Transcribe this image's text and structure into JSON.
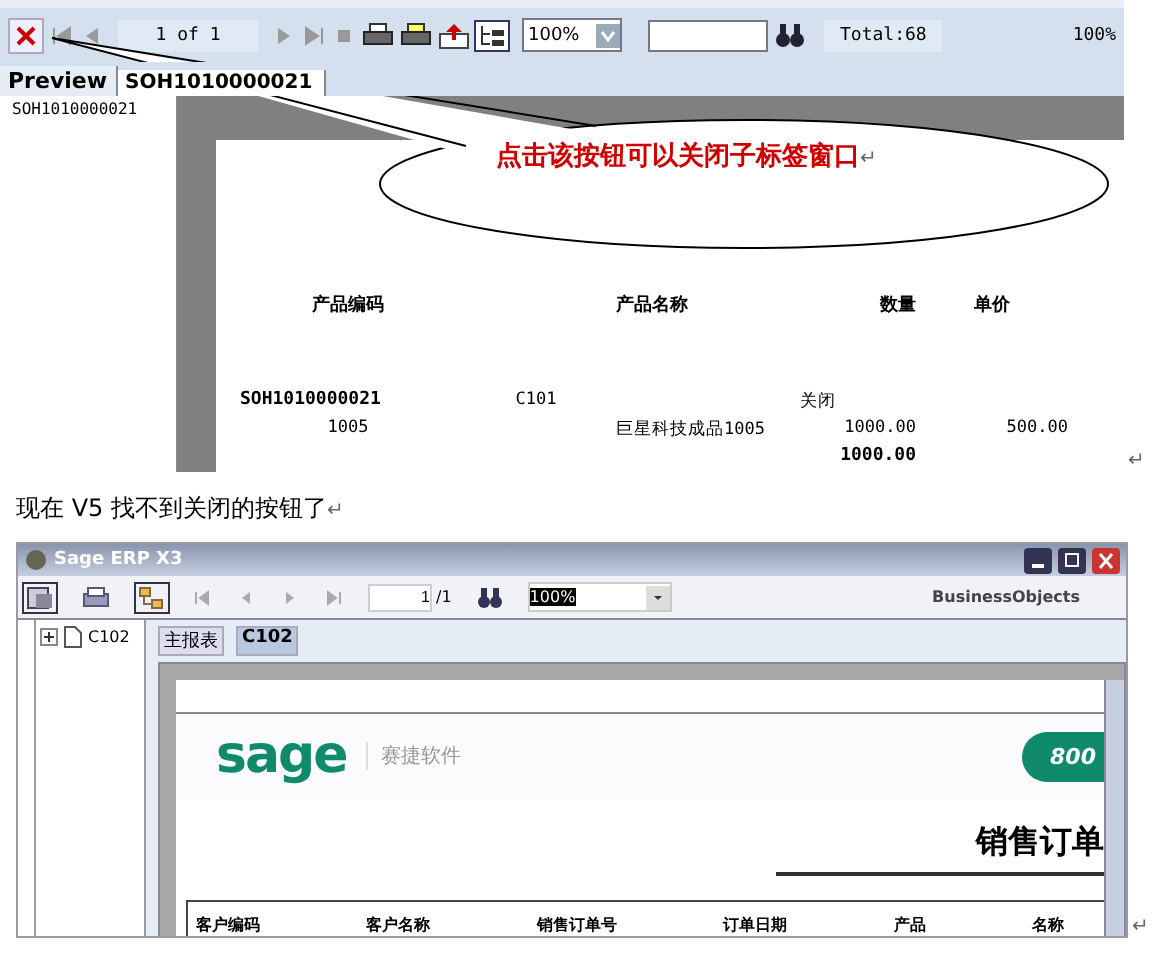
{
  "old_viewer": {
    "toolbar": {
      "page": "1 of 1",
      "zoom": "100%",
      "total": "Total:68",
      "zoom_readout": "100%"
    },
    "tabs": [
      {
        "label": "Preview",
        "selected": false
      },
      {
        "label": "SOH1010000021",
        "selected": true
      }
    ],
    "tree": {
      "items": [
        "SOH1010000021"
      ]
    },
    "callout": {
      "text": "点击该按钮可以关闭子标签窗口",
      "return_mark": "↵"
    },
    "report": {
      "headers": [
        "产品编码",
        "产品名称",
        "数量",
        "单价"
      ],
      "order_no": "SOH1010000021",
      "customer": "C101",
      "status": "关闭",
      "product_code": "1005",
      "product_name": "巨星科技成品1005",
      "quantity": "1000.00",
      "price": "500.00",
      "total_quantity": "1000.00"
    },
    "return_mark": "↵"
  },
  "caption": {
    "text": "现在 V5 找不到关闭的按钮了",
    "return_mark": "↵"
  },
  "new_viewer": {
    "title": "Sage ERP X3",
    "toolbar": {
      "page_input": "1",
      "page_total": "/1",
      "zoom": "100%",
      "brand": "BusinessObjects"
    },
    "tree": {
      "items": [
        "C102"
      ]
    },
    "tabs": [
      {
        "label": "主报表",
        "selected": false
      },
      {
        "label": "C102",
        "selected": true
      }
    ],
    "report": {
      "logo": "sage",
      "logo_subtitle": "赛捷软件",
      "badge": "800",
      "title": "销售订单",
      "columns": [
        "客户编码",
        "客户名称",
        "销售订单号",
        "订单日期",
        "产品",
        "名称"
      ]
    },
    "return_mark": "↵"
  }
}
